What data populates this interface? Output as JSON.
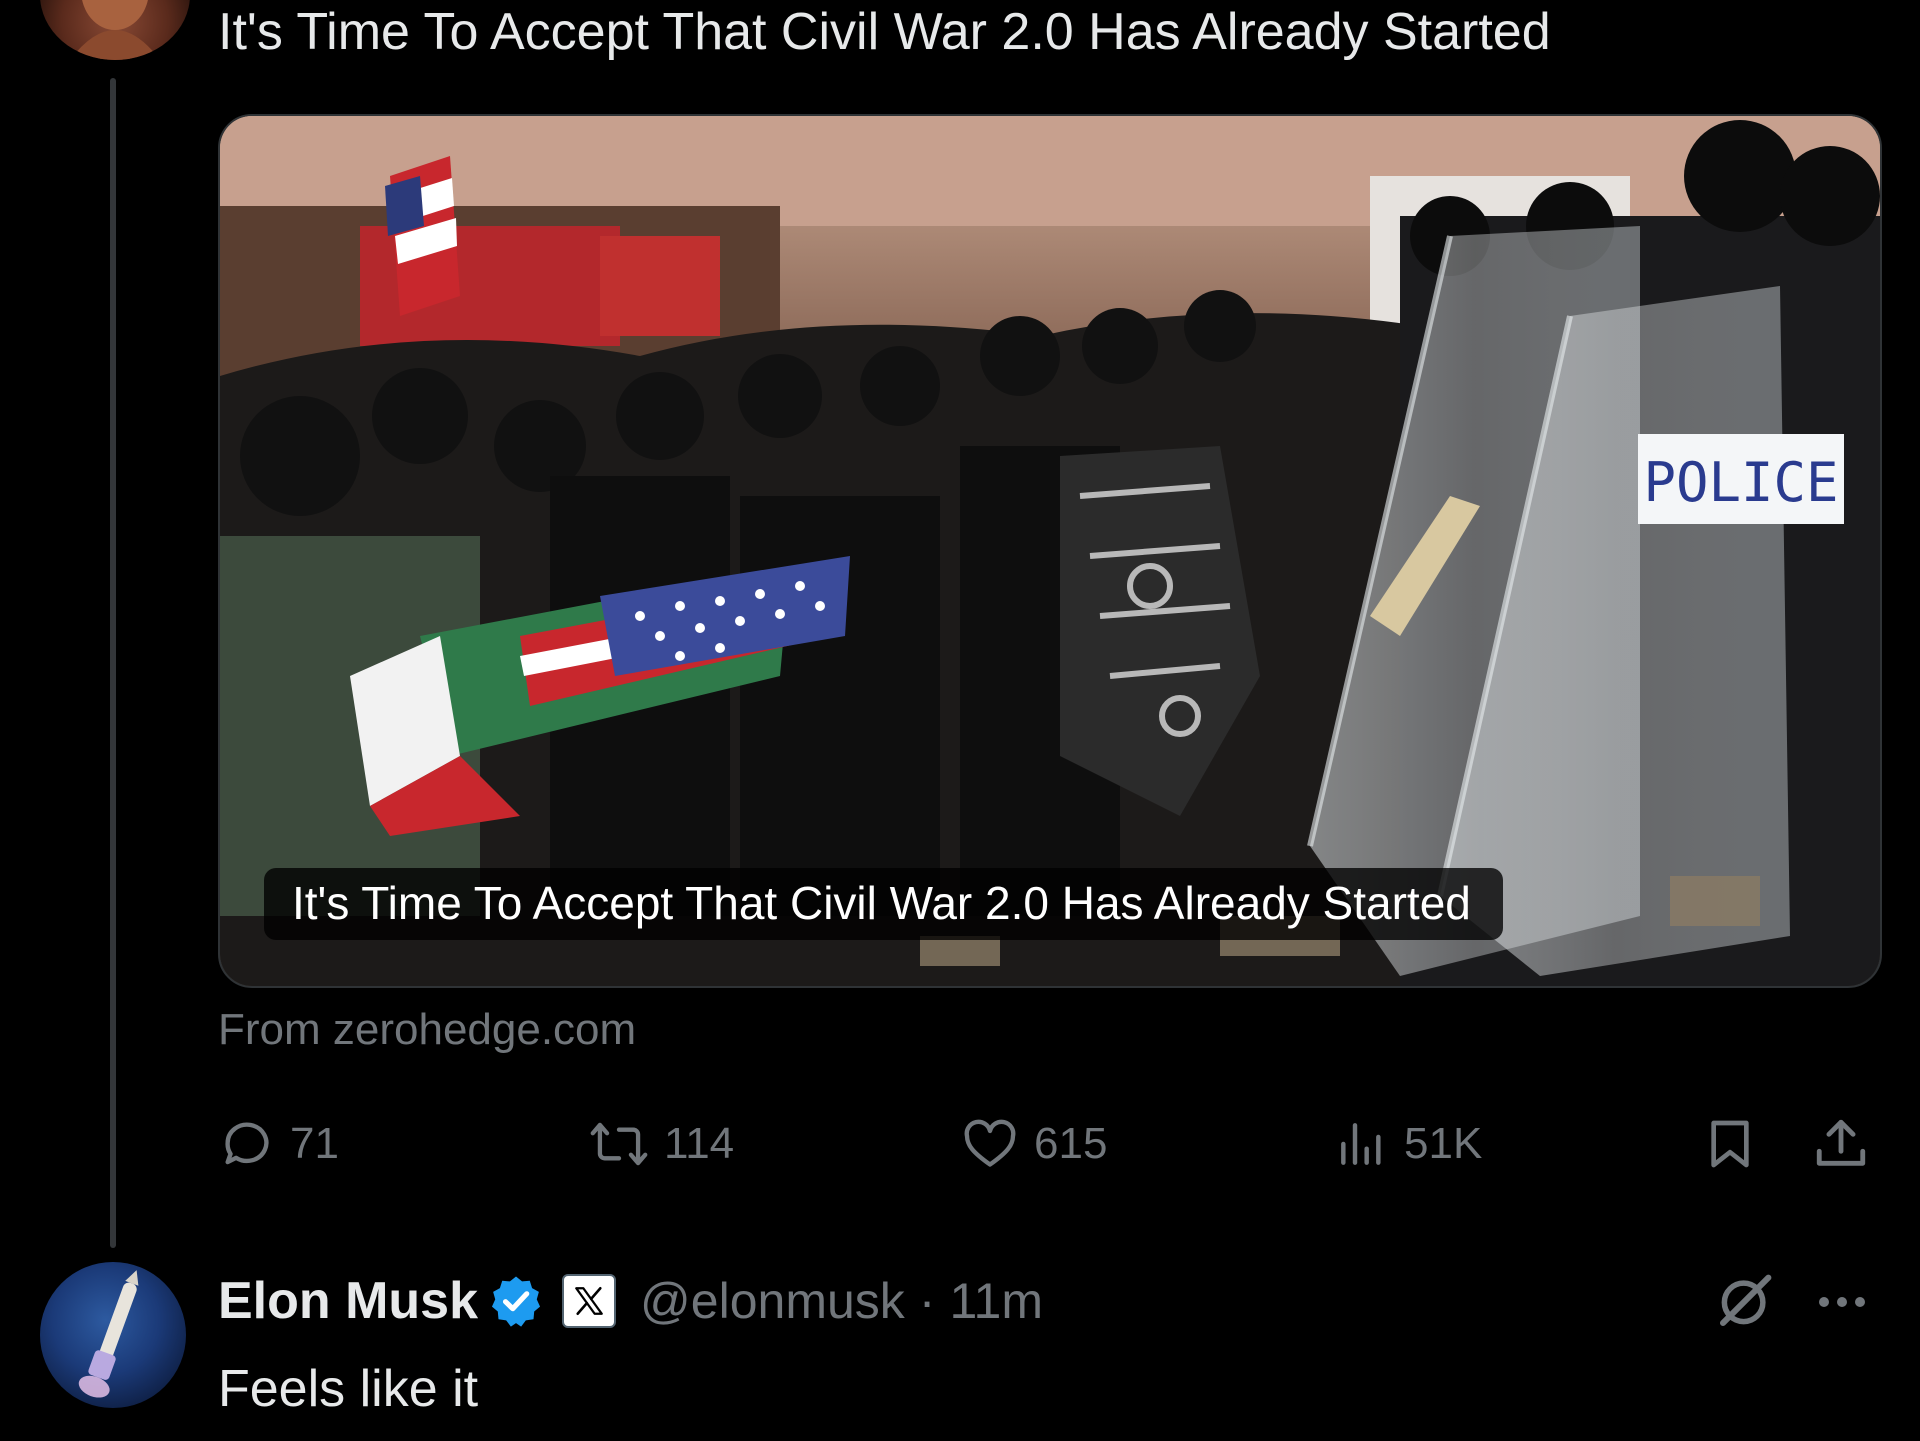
{
  "parent_post": {
    "headline": "It's Time To Accept That Civil War 2.0 Has Already Started",
    "card": {
      "overlay_title": "It's Time To Accept That Civil War 2.0 Has Already Started",
      "source": "From zerohedge.com",
      "image_signage": "POLICE"
    },
    "actions": {
      "replies": "71",
      "reposts": "114",
      "likes": "615",
      "views": "51K"
    }
  },
  "reply_post": {
    "author_name": "Elon Musk",
    "handle": "@elonmusk",
    "separator": "·",
    "time": "11m",
    "text": "Feels like it"
  },
  "colors": {
    "background": "#000000",
    "primary_text": "#e7e9ea",
    "secondary_text": "#71767b",
    "verified_blue": "#1d9bf0",
    "thread_line": "#333639"
  },
  "icons": {
    "reply": "speech-bubble-icon",
    "repost": "repost-arrows-icon",
    "like": "heart-icon",
    "views": "bar-chart-icon",
    "bookmark": "bookmark-icon",
    "share": "share-upload-icon",
    "verified": "verified-badge-icon",
    "affiliation": "x-logo-icon",
    "grok": "grok-slash-icon",
    "more": "ellipsis-icon"
  }
}
